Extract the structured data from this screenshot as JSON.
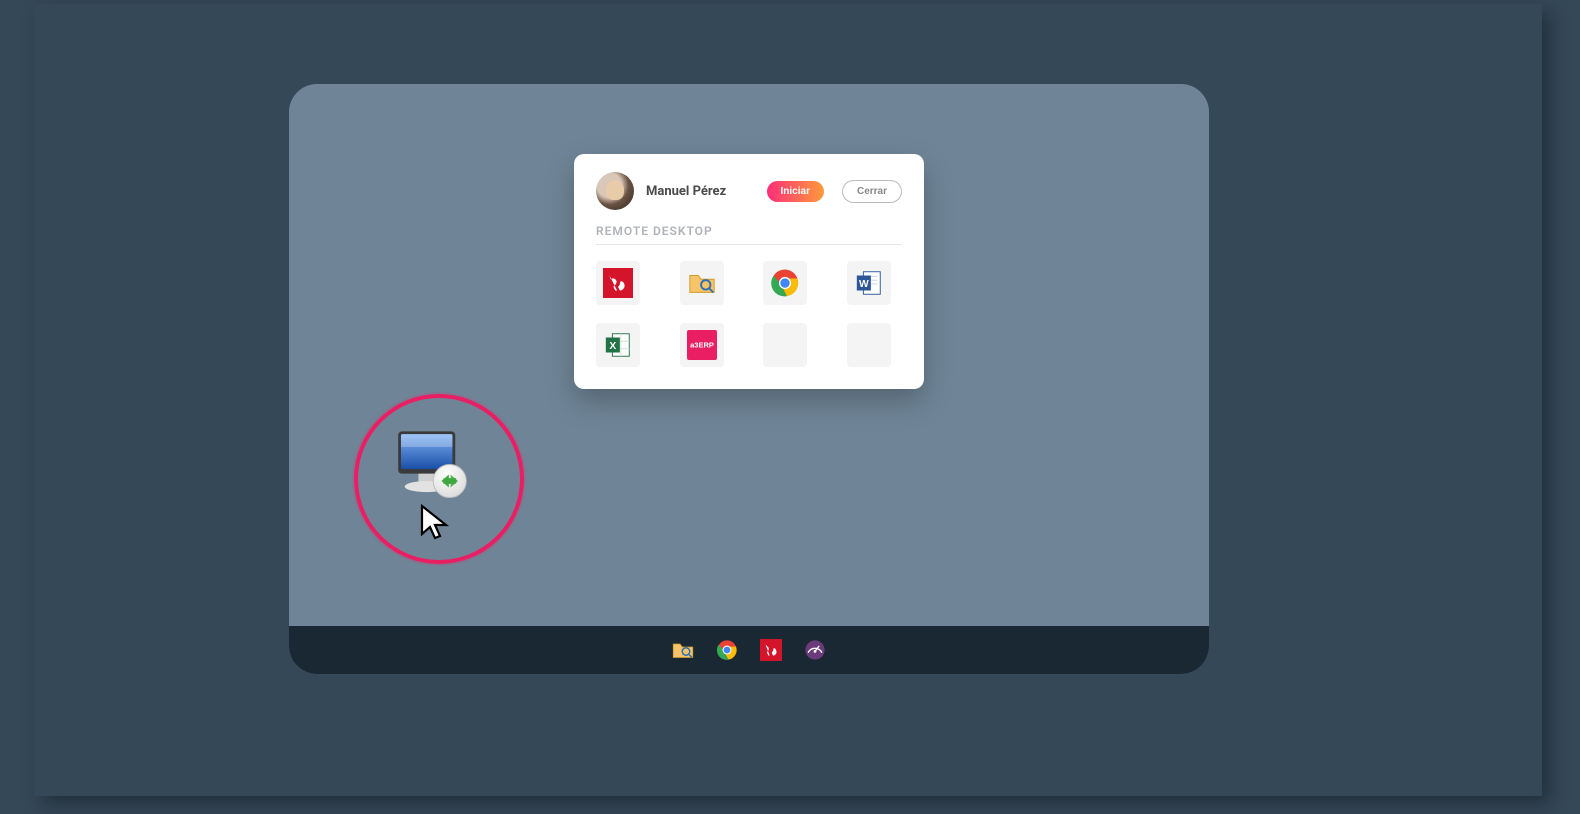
{
  "user": {
    "name": "Manuel Pérez"
  },
  "buttons": {
    "start": "Iniciar",
    "close": "Cerrar"
  },
  "section": {
    "title": "REMOTE DESKTOP"
  },
  "apps": [
    {
      "name": "adobe-reader"
    },
    {
      "name": "file-explorer"
    },
    {
      "name": "chrome"
    },
    {
      "name": "word"
    },
    {
      "name": "excel"
    },
    {
      "name": "a3erp",
      "label": "a3ERP"
    },
    {
      "name": "empty-1"
    },
    {
      "name": "empty-2"
    }
  ],
  "taskbar": [
    {
      "name": "file-explorer"
    },
    {
      "name": "chrome"
    },
    {
      "name": "adobe-reader"
    },
    {
      "name": "speed-test"
    }
  ],
  "colors": {
    "bg_outer": "#354858",
    "bg_desktop": "#6f8597",
    "bg_taskbar": "#1a2833",
    "accent": "#e91e63"
  }
}
